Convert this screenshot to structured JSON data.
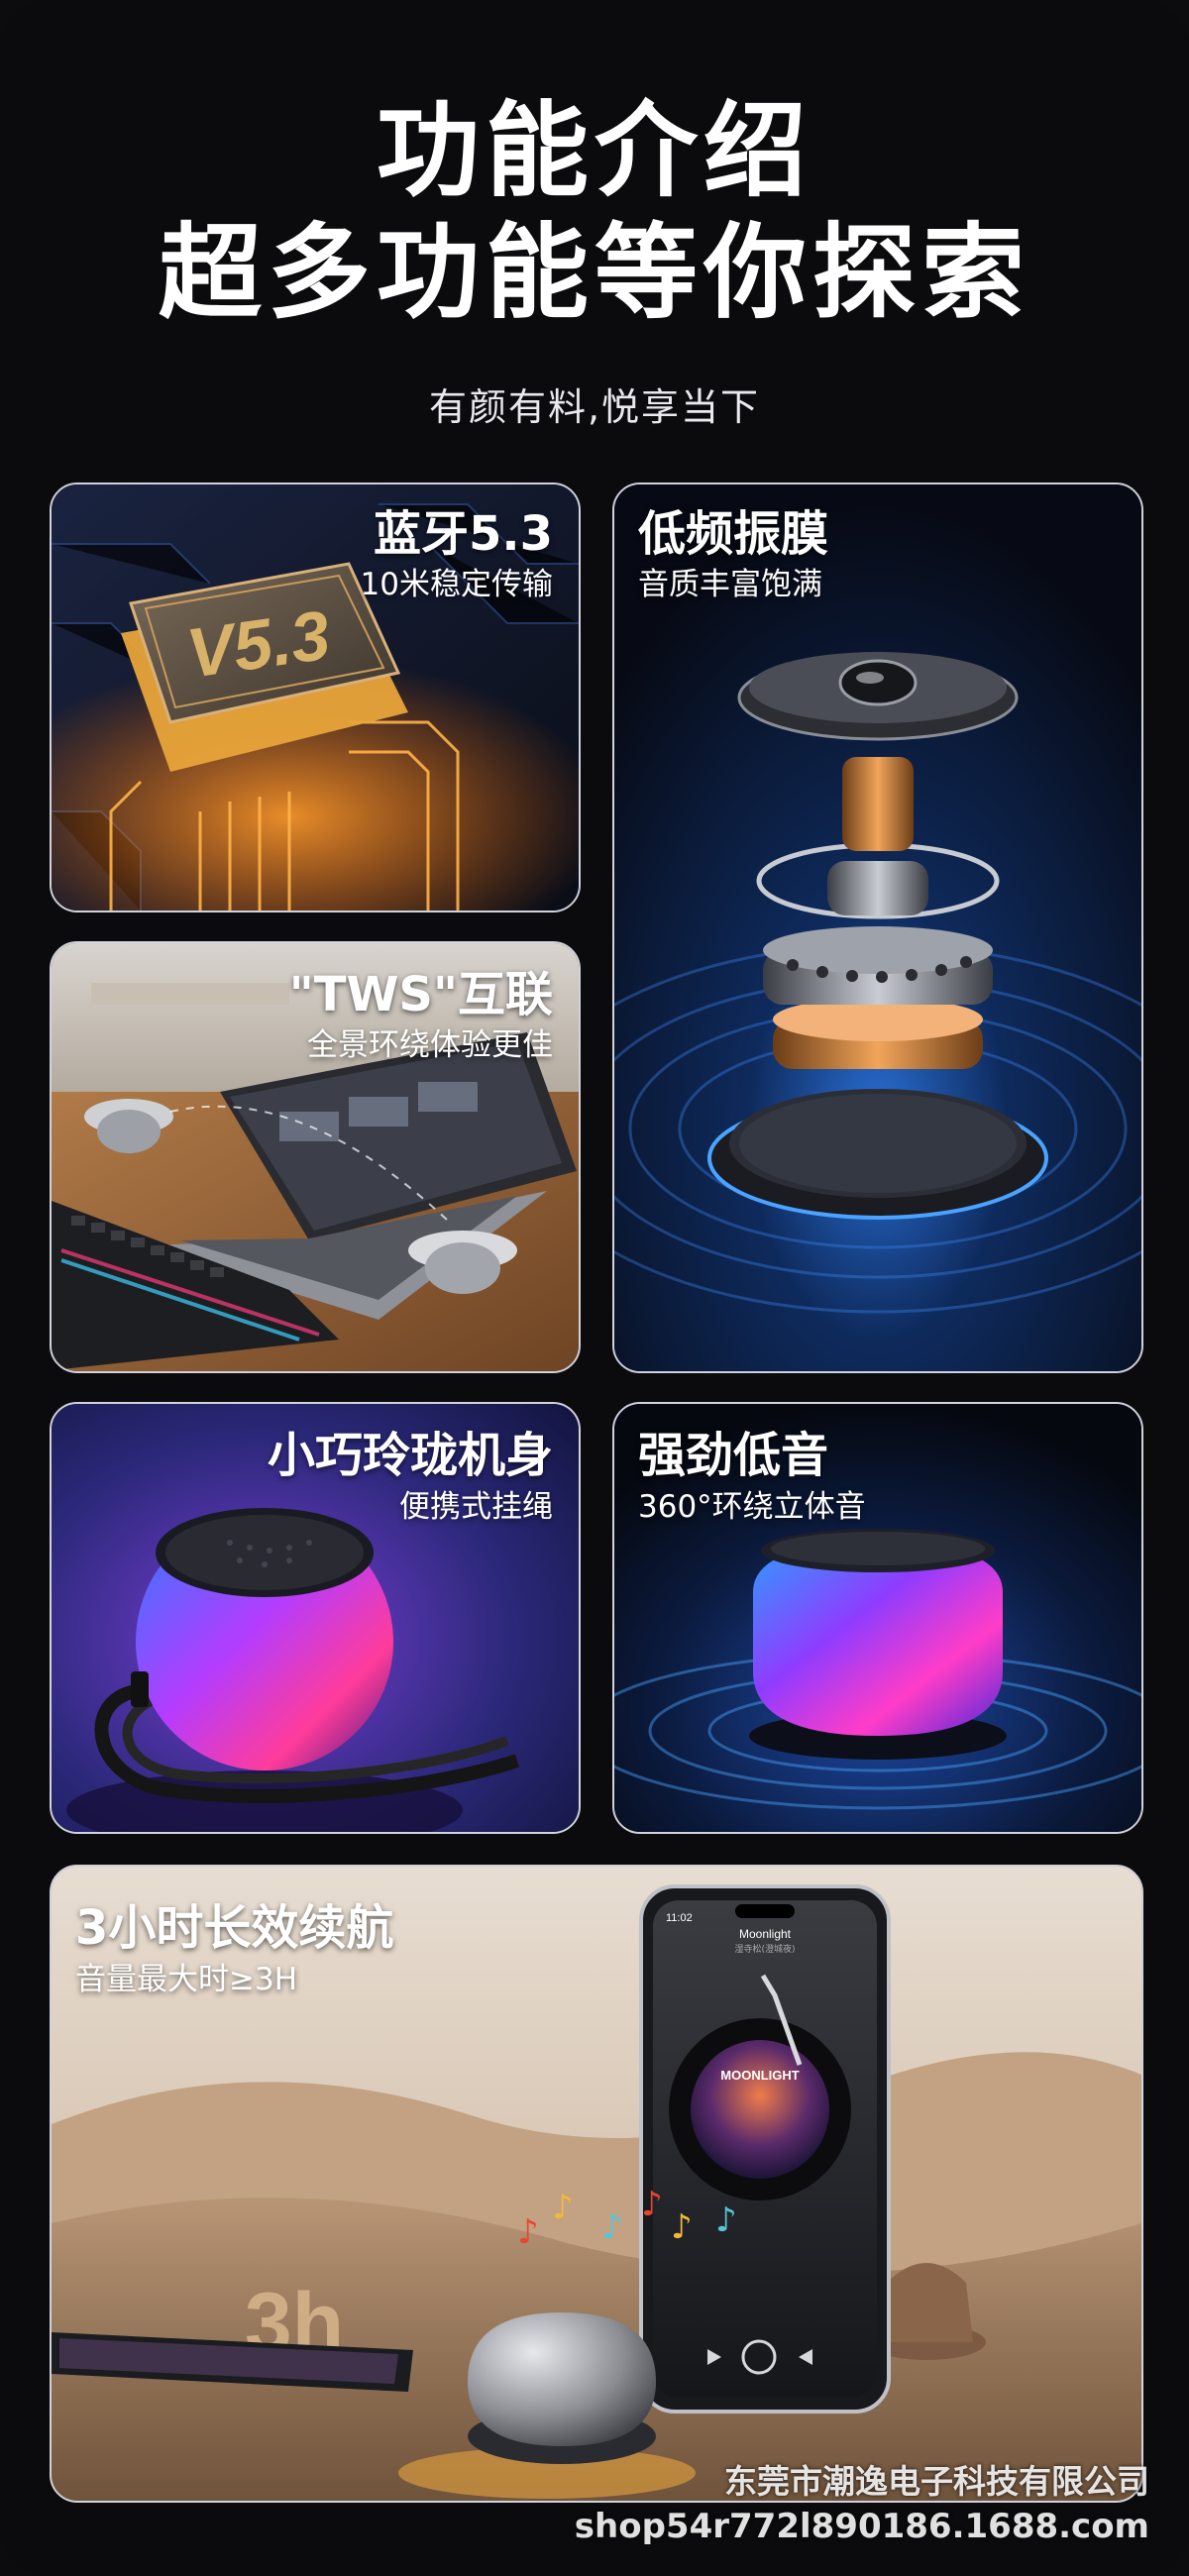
{
  "header": {
    "title_line1": "功能介绍",
    "title_line2": "超多功能等你探索",
    "subtitle": "有颜有料,悦享当下"
  },
  "cards": {
    "bluetooth": {
      "title": "蓝牙5.3",
      "subtitle": "10米稳定传输",
      "chip_label": "V5.3"
    },
    "bass_diaphragm": {
      "title": "低频振膜",
      "subtitle": "音质丰富饱满"
    },
    "tws": {
      "title": "\"TWS\"互联",
      "subtitle": "全景环绕体验更佳"
    },
    "compact": {
      "title": "小巧玲珑机身",
      "subtitle": "便携式挂绳"
    },
    "bass": {
      "title": "强劲低音",
      "subtitle": "360°环绕立体音"
    },
    "battery": {
      "title": "3小时长效续航",
      "subtitle": "音量最大时≥3H",
      "badge": "3h",
      "phone_time": "11:02",
      "phone_song": "Moonlight",
      "phone_artist": "湿寺松(澄城夜)",
      "album_text": "MOONLIGHT"
    }
  },
  "watermark": {
    "company": "东莞市潮逸电子科技有限公司",
    "shop": "shop54r772l890186.1688.com"
  },
  "colors": {
    "background": "#0b0b0d",
    "card_border": "#d0d2dc",
    "chip_gold": "#e8a43a",
    "speaker_purple": "#b43cff",
    "speaker_blue": "#2f7bff"
  }
}
